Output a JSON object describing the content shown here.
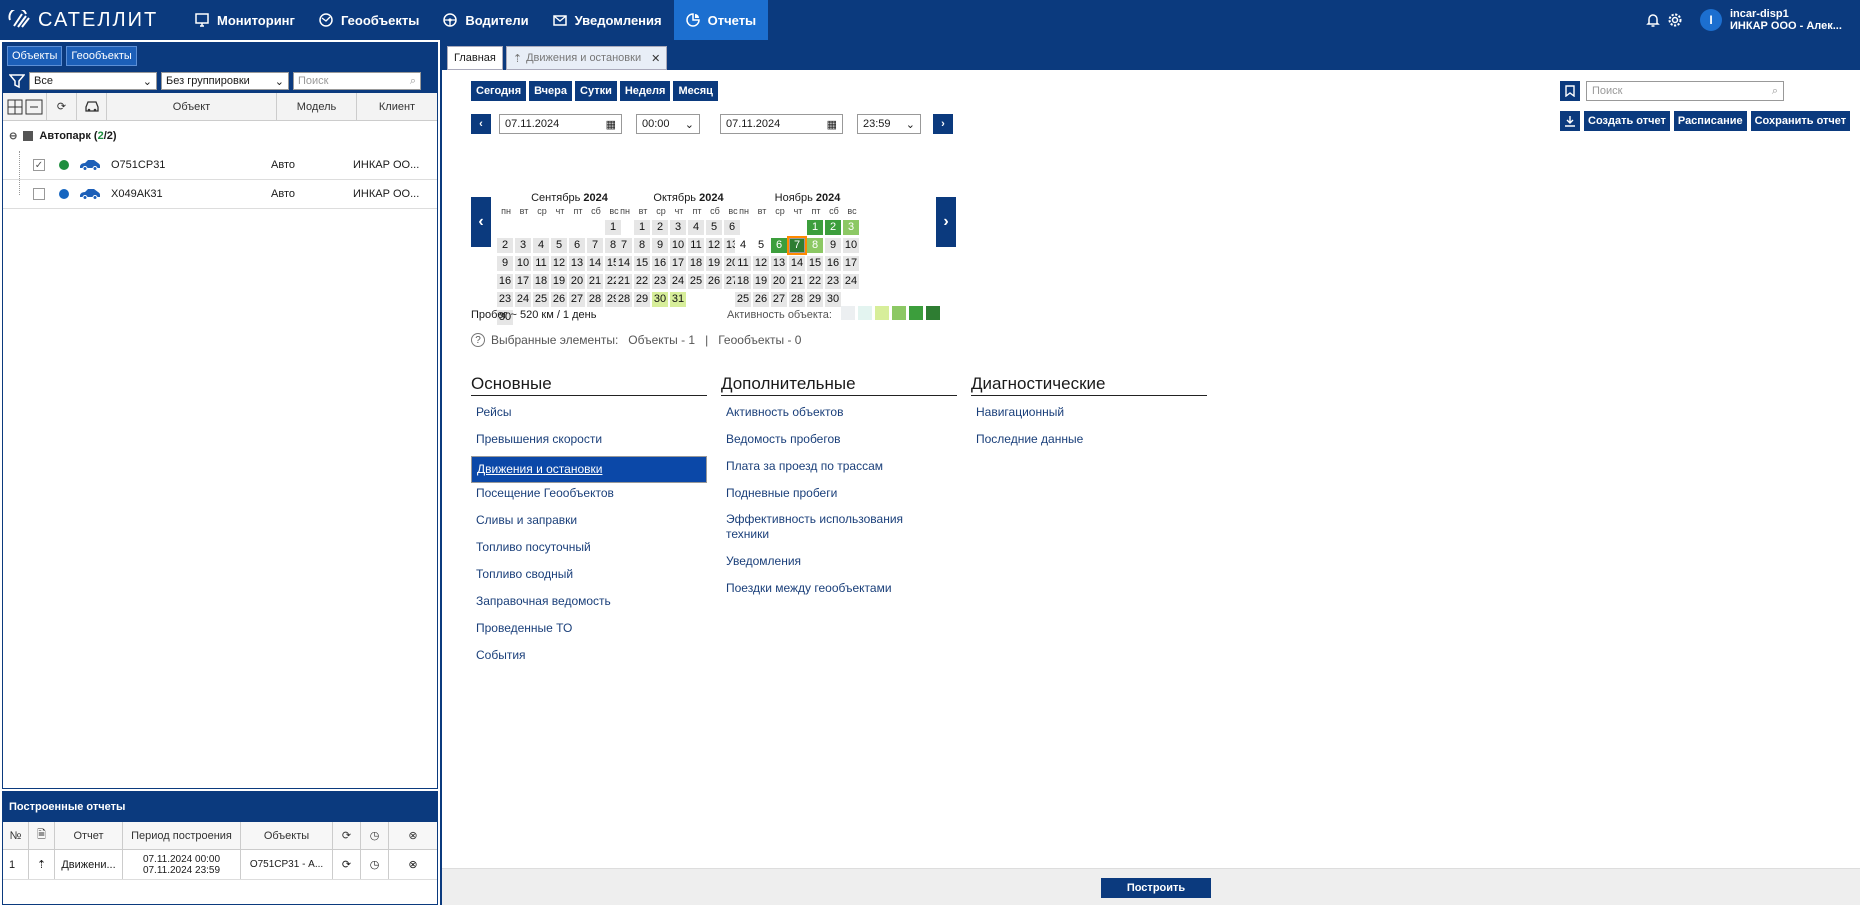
{
  "app": {
    "logo_text": "САТЕЛЛИТ"
  },
  "nav": [
    {
      "label": "Мониторинг",
      "icon": "monitor-icon"
    },
    {
      "label": "Геообъекты",
      "icon": "geo-icon"
    },
    {
      "label": "Водители",
      "icon": "steering-icon"
    },
    {
      "label": "Уведомления",
      "icon": "envelope-icon"
    },
    {
      "label": "Отчеты",
      "icon": "report-icon",
      "active": true
    }
  ],
  "user": {
    "avatar_letter": "I",
    "login": "incar-disp1",
    "org": "ИНКАР ООО - Алек..."
  },
  "left_panel": {
    "tabs": [
      "Объекты",
      "Геообъекты"
    ],
    "filter_value": "Все",
    "grouping_value": "Без группировки",
    "search_placeholder": "Поиск",
    "columns": {
      "object": "Объект",
      "model": "Модель",
      "client": "Клиент"
    },
    "group": {
      "name": "Автопарк",
      "count_open": "(",
      "count_a": "2",
      "count_sep": "/2)"
    },
    "vehicles": [
      {
        "checked": "✓",
        "plate": "О751СР31",
        "model": "Авто",
        "client": "ИНКАР ОО...",
        "status_color": "#1e8e3e"
      },
      {
        "checked": "",
        "plate": "Х049АК31",
        "model": "Авто",
        "client": "ИНКАР ОО...",
        "status_color": "#1565c0"
      }
    ]
  },
  "built_reports": {
    "title": "Построенные отчеты",
    "columns": {
      "num": "№",
      "report": "Отчет",
      "period": "Период построения",
      "objects": "Объекты"
    },
    "rows": [
      {
        "num": "1",
        "report": "Движени...",
        "period_from": "07.11.2024 00:00",
        "period_to": "07.11.2024 23:59",
        "objects": "О751СР31 - А..."
      }
    ]
  },
  "main_tabs": [
    {
      "label": "Главная",
      "active": true
    },
    {
      "label": "Движения и остановки",
      "active": false
    }
  ],
  "quick_periods": [
    "Сегодня",
    "Вчера",
    "Сутки",
    "Неделя",
    "Месяц"
  ],
  "period": {
    "date_from": "07.11.2024",
    "time_from": "00:00",
    "date_to": "07.11.2024",
    "time_to": "23:59"
  },
  "right_tools": {
    "search_placeholder": "Поиск",
    "create": "Создать отчет",
    "schedule": "Расписание",
    "save": "Сохранить отчет"
  },
  "calendar": {
    "dow": [
      "пн",
      "вт",
      "ср",
      "чт",
      "пт",
      "сб",
      "вс"
    ],
    "months": [
      {
        "name": "Сентябрь",
        "year": "2024",
        "offset": 6,
        "days": 30,
        "activity": {}
      },
      {
        "name": "Октябрь",
        "year": "2024",
        "offset": 1,
        "days": 31,
        "activity": {
          "30": "a1",
          "31": "a1"
        }
      },
      {
        "name": "Ноябрь",
        "year": "2024",
        "offset": 4,
        "days": 30,
        "activity": {
          "1": "a3",
          "2": "a3",
          "3": "a2",
          "4": "lite",
          "5": "lite",
          "6": "a3",
          "7": "sel",
          "8": "a2"
        }
      }
    ],
    "mileage": "Пробег ~ 520 км / 1 день",
    "activity_label": "Активность объекта:",
    "activity_colors": [
      "#eceff1",
      "#e3f4f0",
      "#d7ee9a",
      "#8cc864",
      "#3c9e3c",
      "#2e7d32"
    ]
  },
  "selected": {
    "label": "Выбранные элементы:",
    "objects": "Объекты - 1",
    "sep": "|",
    "geo": "Геообъекты - 0"
  },
  "sections": [
    {
      "title": "Основные",
      "items": [
        "Рейсы",
        "Превышения скорости",
        "Движения и остановки",
        "Посещение Геообъектов",
        "Сливы и заправки",
        "Топливо посуточный",
        "Топливо сводный",
        "Заправочная ведомость",
        "Проведенные ТО",
        "События"
      ],
      "selected": 2
    },
    {
      "title": "Дополнительные",
      "items": [
        "Активность объектов",
        "Ведомость пробегов",
        "Плата за проезд по трассам",
        "Подневные пробеги",
        "Эффективность использования техники",
        "Уведомления",
        "Поездки между геообъектами"
      ],
      "selected": -1
    },
    {
      "title": "Диагностические",
      "items": [
        "Навигационный",
        "Последние данные"
      ],
      "selected": -1
    }
  ],
  "build_button": "Построить"
}
